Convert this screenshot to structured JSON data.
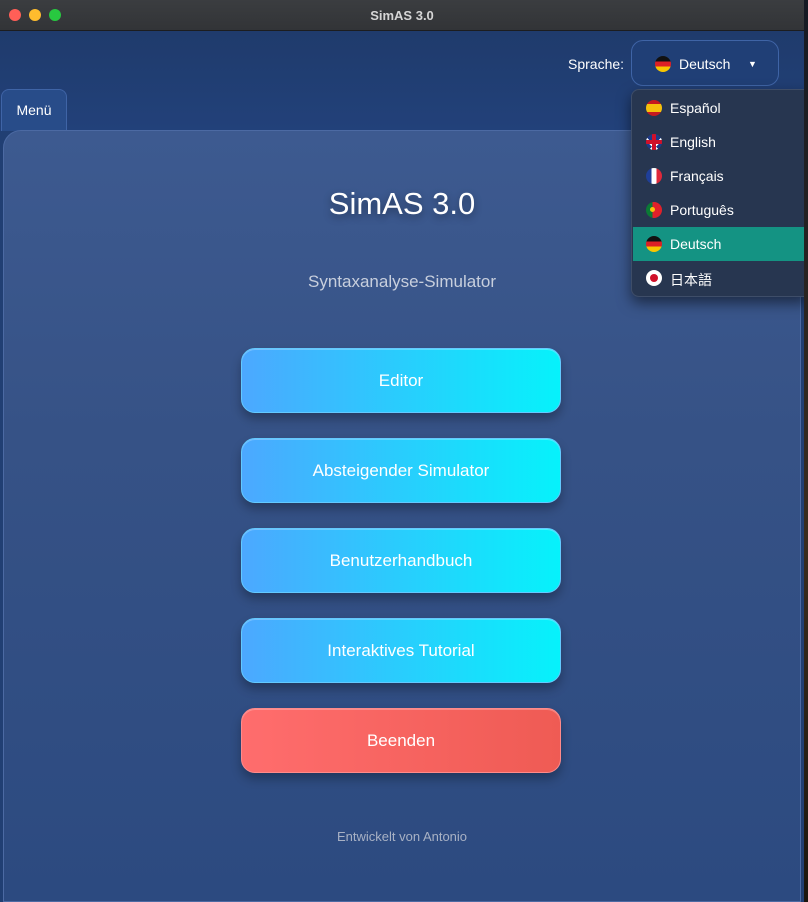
{
  "window": {
    "title": "SimAS 3.0"
  },
  "language": {
    "label": "Sprache:",
    "selected": "Deutsch",
    "options": [
      {
        "label": "Español",
        "flag": "spain-flag-icon"
      },
      {
        "label": "English",
        "flag": "uk-flag-icon"
      },
      {
        "label": "Français",
        "flag": "france-flag-icon"
      },
      {
        "label": "Português",
        "flag": "portugal-flag-icon"
      },
      {
        "label": "Deutsch",
        "flag": "germany-flag-icon"
      },
      {
        "label": "日本語",
        "flag": "japan-flag-icon"
      }
    ]
  },
  "tabs": [
    {
      "label": "Menü"
    }
  ],
  "main": {
    "title": "SimAS 3.0",
    "subtitle": "Syntaxanalyse-Simulator",
    "buttons": [
      {
        "label": "Editor"
      },
      {
        "label": "Absteigender Simulator"
      },
      {
        "label": "Benutzerhandbuch"
      },
      {
        "label": "Interaktives Tutorial"
      },
      {
        "label": "Beenden"
      }
    ],
    "footer": "Entwickelt von Antonio"
  },
  "colors": {
    "accent_gradient_start": "#4ca8ff",
    "accent_gradient_end": "#06f2fb",
    "danger": "#ff6d6d",
    "selected_item": "#149383",
    "background": "#213f73"
  }
}
